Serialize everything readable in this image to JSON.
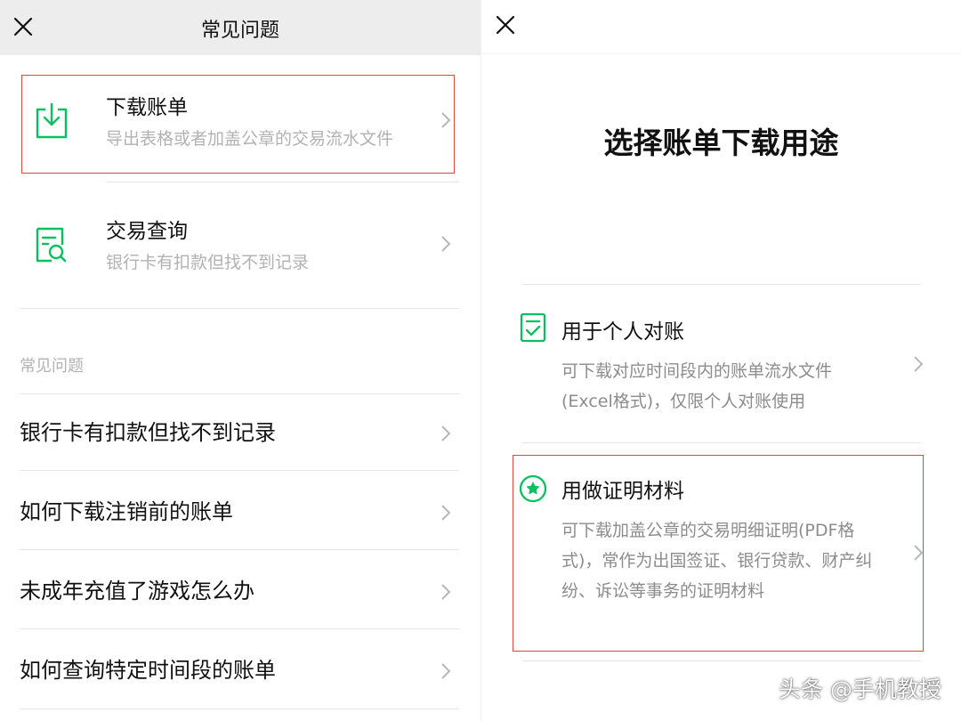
{
  "left_panel": {
    "nav_title": "常见问题",
    "entries": [
      {
        "title": "下载账单",
        "desc": "导出表格或者加盖公章的交易流水文件",
        "icon": "download-icon",
        "highlighted": true
      },
      {
        "title": "交易查询",
        "desc": "银行卡有扣款但找不到记录",
        "icon": "search-document-icon",
        "highlighted": false
      }
    ],
    "section_label": "常见问题",
    "faq_items": [
      "银行卡有扣款但找不到记录",
      "如何下载注销前的账单",
      "未成年充值了游戏怎么办",
      "如何查询特定时间段的账单"
    ]
  },
  "right_panel": {
    "title": "选择账单下载用途",
    "options": [
      {
        "title": "用于个人对账",
        "desc": "可下载对应时间段内的账单流水文件(Excel格式)，仅限个人对账使用",
        "icon": "checklist-icon",
        "highlighted": false
      },
      {
        "title": "用做证明材料",
        "desc": "可下载加盖公章的交易明细证明(PDF格式)，常作为出国签证、银行贷款、财产纠纷、诉讼等事务的证明材料",
        "icon": "star-badge-icon",
        "highlighted": true
      }
    ]
  },
  "watermark": "头条 @手机教授",
  "colors": {
    "accent_green": "#07c160",
    "highlight_red": "#e2473b",
    "secondary_text": "#b2b2b2",
    "nav_background": "#ededed"
  }
}
